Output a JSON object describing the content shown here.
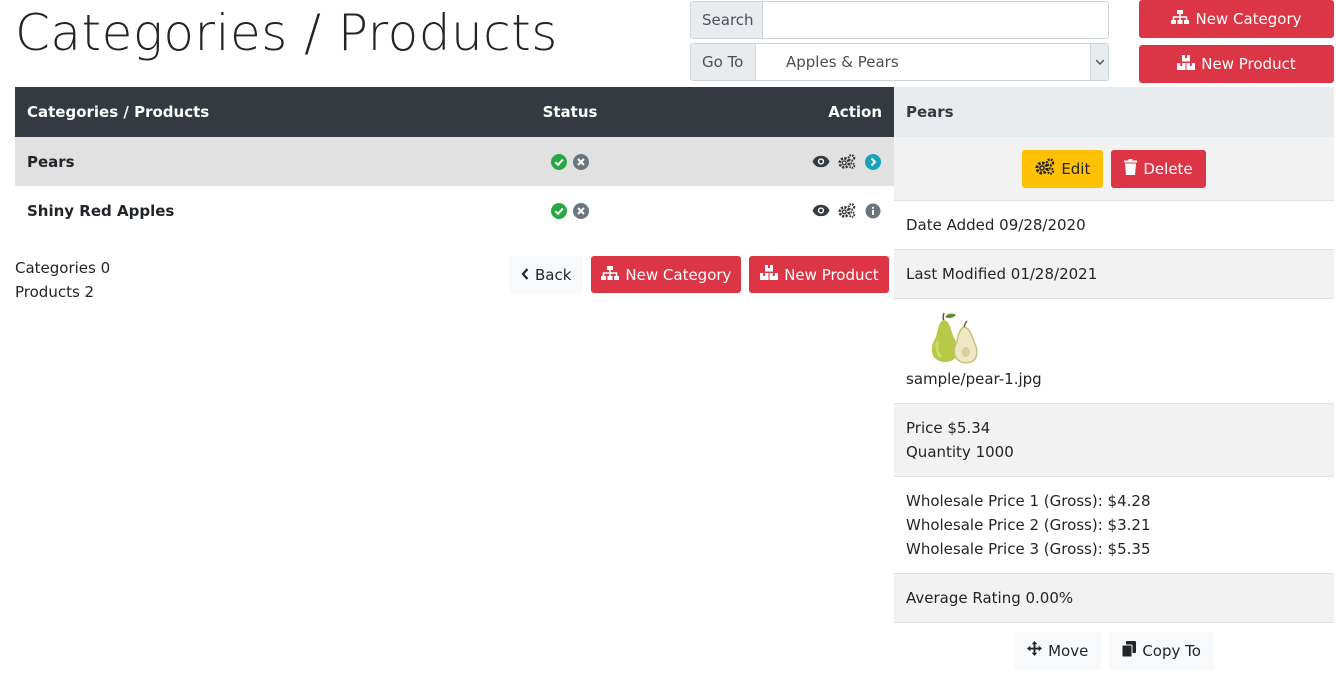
{
  "page": {
    "title": "Categories / Products"
  },
  "search": {
    "label": "Search",
    "value": "",
    "placeholder": ""
  },
  "goto": {
    "label": "Go To",
    "selected": "Apples & Pears"
  },
  "header_buttons": {
    "new_category": "New Category",
    "new_product": "New Product"
  },
  "table": {
    "headers": {
      "name": "Categories / Products",
      "status": "Status",
      "action": "Action"
    },
    "rows": [
      {
        "name": "Pears",
        "active": true
      },
      {
        "name": "Shiny Red Apples",
        "active": false
      }
    ]
  },
  "counts": {
    "categories": "Categories 0",
    "products": "Products 2"
  },
  "bottom_buttons": {
    "back": "Back",
    "new_category": "New Category",
    "new_product": "New Product"
  },
  "panel": {
    "title": "Pears",
    "edit": "Edit",
    "delete": "Delete",
    "date_added": "Date Added 09/28/2020",
    "last_modified": "Last Modified 01/28/2021",
    "image_file": "sample/pear-1.jpg",
    "price": "Price $5.34",
    "quantity": "Quantity 1000",
    "wholesale": [
      "Wholesale Price 1 (Gross): $4.28",
      "Wholesale Price 2 (Gross): $3.21",
      "Wholesale Price 3 (Gross): $5.35"
    ],
    "rating": "Average Rating 0.00%",
    "move": "Move",
    "copy_to": "Copy To"
  },
  "colors": {
    "danger": "#dc3545",
    "warning": "#ffc107",
    "dark": "#343a40",
    "success": "#28a745",
    "info": "#17a2b8"
  },
  "icons": [
    "sitemap-icon",
    "boxes-icon",
    "check-circle-icon",
    "times-circle-icon",
    "eye-icon",
    "cogs-icon",
    "chevron-right-circle-icon",
    "info-circle-icon",
    "chevron-left-icon",
    "trash-icon",
    "arrows-move-icon",
    "copy-icon"
  ]
}
